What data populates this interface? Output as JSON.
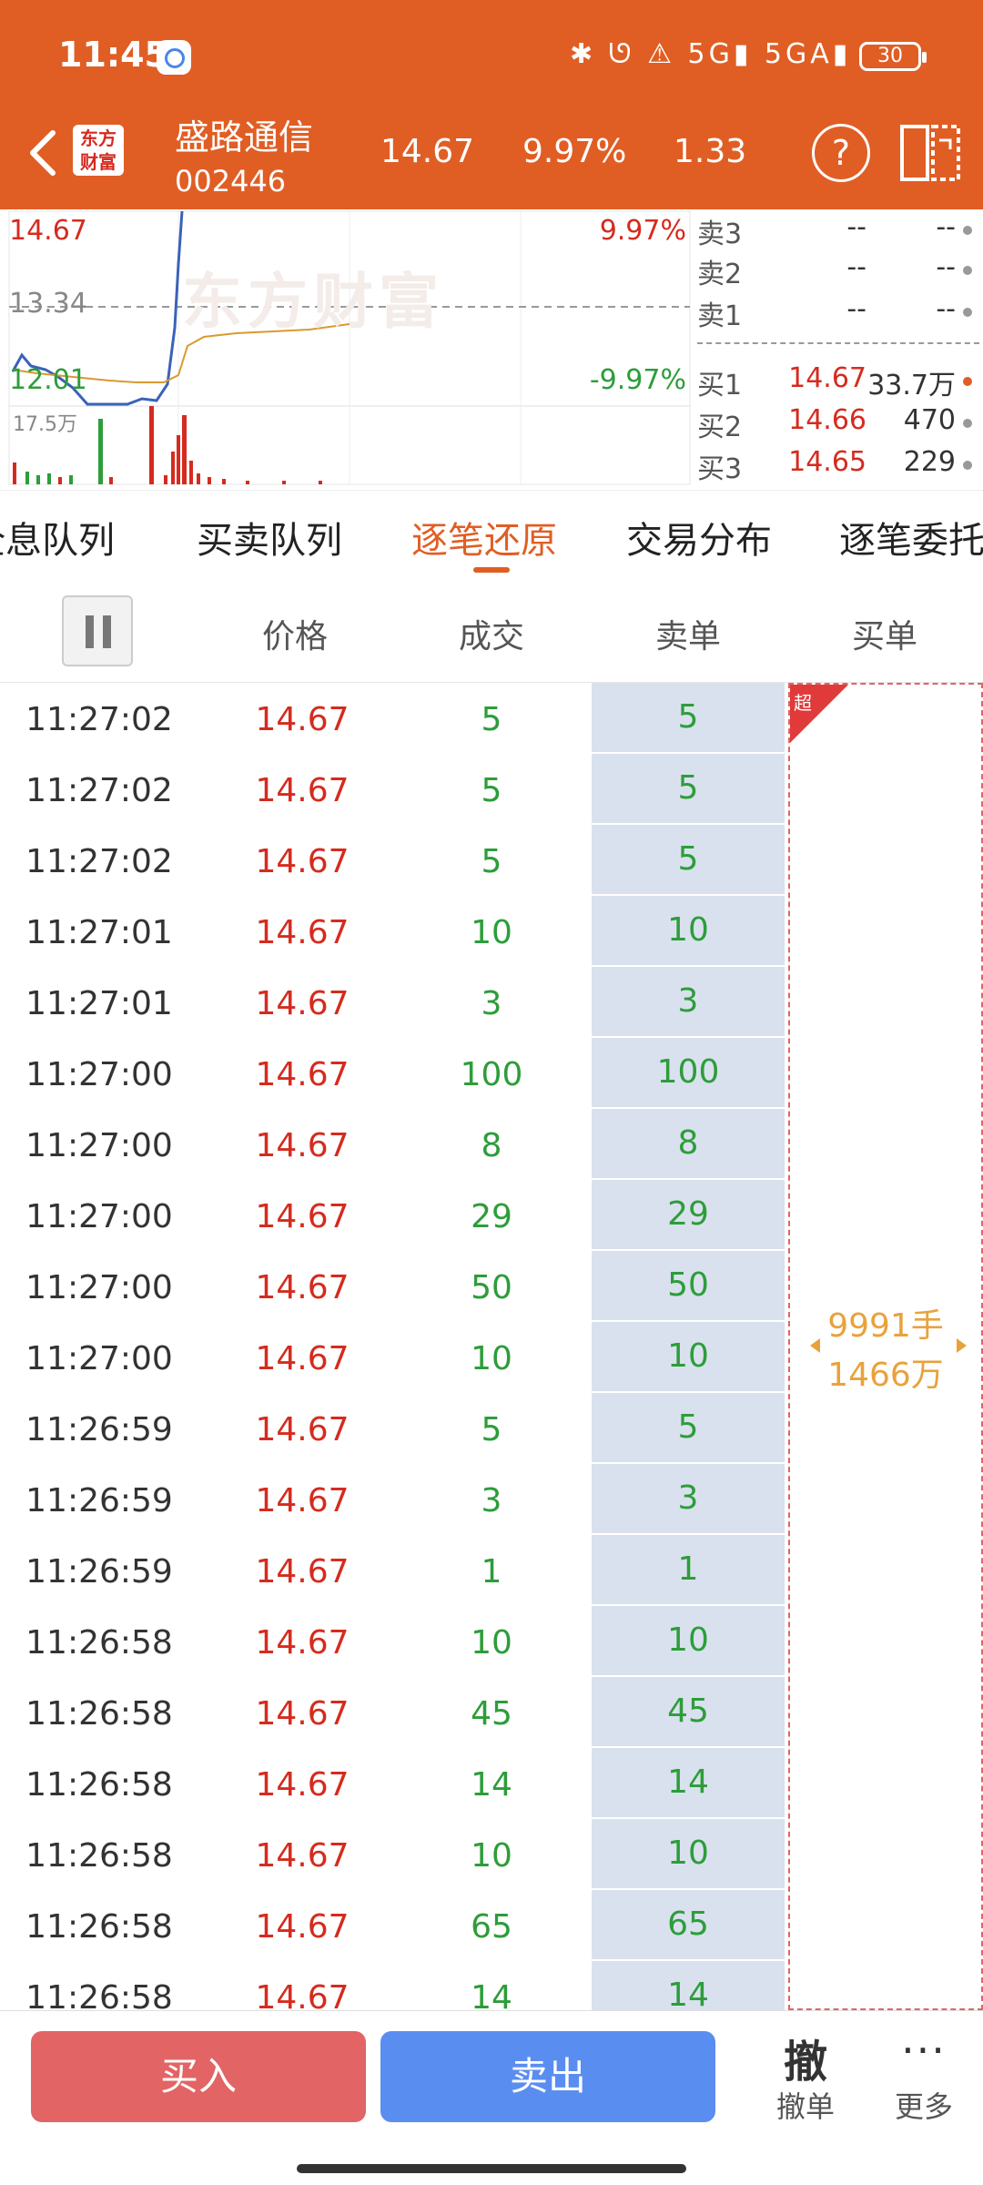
{
  "status_bar": {
    "time": "11:45",
    "icons_text": "✱ ᘎ ⚠ 5G▮ 5GA▮",
    "battery": "30"
  },
  "header": {
    "logo_text": "东方财富",
    "stock_name": "盛路通信",
    "stock_code": "002446",
    "price": "14.67",
    "change_pct": "9.97%",
    "change": "1.33",
    "colors": {
      "bg": "#E05E24",
      "text": "#ffffff"
    }
  },
  "chart": {
    "price_high": "14.67",
    "price_mid": "13.34",
    "price_low": "12.01",
    "pct_high": "9.97%",
    "pct_low": "-9.97%",
    "volume_label": "17.5万",
    "watermark": "东方财富"
  },
  "order_book": {
    "asks": [
      {
        "label": "卖3",
        "price": "--",
        "volume": "--"
      },
      {
        "label": "卖2",
        "price": "--",
        "volume": "--"
      },
      {
        "label": "卖1",
        "price": "--",
        "volume": "--"
      }
    ],
    "bids": [
      {
        "label": "买1",
        "price": "14.67",
        "volume": "33.7万"
      },
      {
        "label": "买2",
        "price": "14.66",
        "volume": "470"
      },
      {
        "label": "买3",
        "price": "14.65",
        "volume": "229"
      }
    ]
  },
  "tabs": [
    "全息队列",
    "买卖队列",
    "逐笔还原",
    "交易分布",
    "逐笔委托"
  ],
  "active_tab": "逐笔还原",
  "table_header": {
    "price": "价格",
    "volume": "成交",
    "sell": "卖单",
    "buy": "买单"
  },
  "trades": [
    {
      "time": "11:27:02",
      "price": "14.67",
      "volume": "5",
      "sell": "5"
    },
    {
      "time": "11:27:02",
      "price": "14.67",
      "volume": "5",
      "sell": "5"
    },
    {
      "time": "11:27:02",
      "price": "14.67",
      "volume": "5",
      "sell": "5"
    },
    {
      "time": "11:27:01",
      "price": "14.67",
      "volume": "10",
      "sell": "10"
    },
    {
      "time": "11:27:01",
      "price": "14.67",
      "volume": "3",
      "sell": "3"
    },
    {
      "time": "11:27:00",
      "price": "14.67",
      "volume": "100",
      "sell": "100"
    },
    {
      "time": "11:27:00",
      "price": "14.67",
      "volume": "8",
      "sell": "8"
    },
    {
      "time": "11:27:00",
      "price": "14.67",
      "volume": "29",
      "sell": "29"
    },
    {
      "time": "11:27:00",
      "price": "14.67",
      "volume": "50",
      "sell": "50"
    },
    {
      "time": "11:27:00",
      "price": "14.67",
      "volume": "10",
      "sell": "10"
    },
    {
      "time": "11:26:59",
      "price": "14.67",
      "volume": "5",
      "sell": "5"
    },
    {
      "time": "11:26:59",
      "price": "14.67",
      "volume": "3",
      "sell": "3"
    },
    {
      "time": "11:26:59",
      "price": "14.67",
      "volume": "1",
      "sell": "1"
    },
    {
      "time": "11:26:58",
      "price": "14.67",
      "volume": "10",
      "sell": "10"
    },
    {
      "time": "11:26:58",
      "price": "14.67",
      "volume": "45",
      "sell": "45"
    },
    {
      "time": "11:26:58",
      "price": "14.67",
      "volume": "14",
      "sell": "14"
    },
    {
      "time": "11:26:58",
      "price": "14.67",
      "volume": "10",
      "sell": "10"
    },
    {
      "time": "11:26:58",
      "price": "14.67",
      "volume": "65",
      "sell": "65"
    },
    {
      "time": "11:26:58",
      "price": "14.67",
      "volume": "14",
      "sell": "14"
    }
  ],
  "buy_order": {
    "badge": "超",
    "lots": "9991手",
    "amount": "1466万"
  },
  "bottom": {
    "buy": "买入",
    "sell": "卖出",
    "cancel_glyph": "撤",
    "cancel": "撤单",
    "more_glyph": "···",
    "more": "更多"
  },
  "icons": {
    "back": "chevron-left-icon",
    "help": "question-icon",
    "layout": "split-screen-icon",
    "pause": "pause-icon"
  }
}
